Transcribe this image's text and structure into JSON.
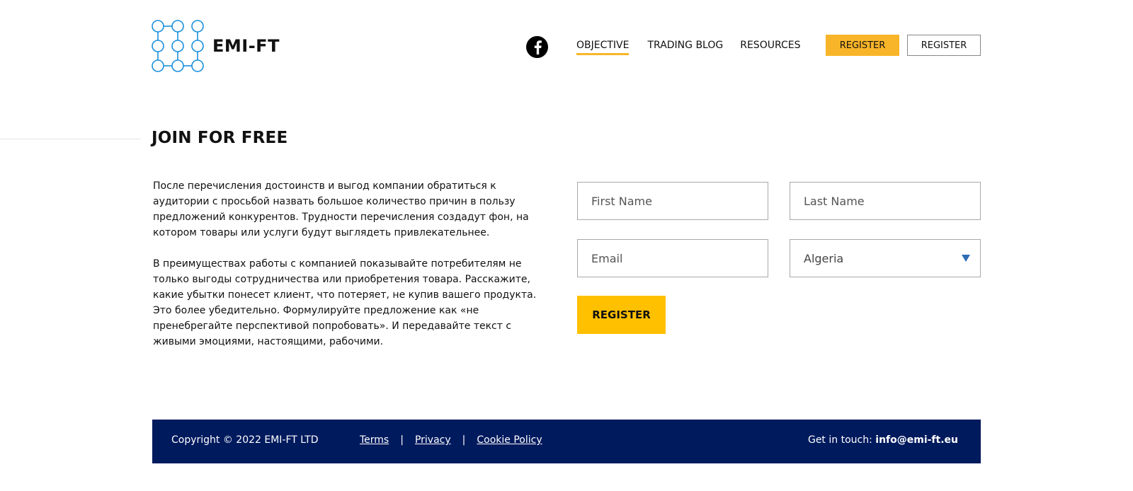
{
  "header": {
    "logo_text": "EMI-FT",
    "social": "facebook-icon",
    "nav": [
      {
        "label": "OBJECTIVE",
        "active": true
      },
      {
        "label": "TRADING BLOG",
        "active": false
      },
      {
        "label": "RESOURCES",
        "active": false
      }
    ],
    "register_primary": "REGISTER",
    "register_secondary": "REGISTER"
  },
  "main": {
    "title": "JOIN FOR FREE",
    "paragraphs": [
      "После перечисления достоинств и выгод компании обратиться к аудитории с просьбой назвать большое количество причин в пользу предложений конкурентов. Трудности перечисления создадут фон, на котором товары или услуги будут выглядеть привлекательнее.",
      "В преимуществах работы с компанией показывайте потребителям не только выгоды сотрудничества или приобретения товара. Расскажите, какие убытки понесет клиент, что потеряет, не купив вашего продукта. Это более убедительно. Формулируйте предложение как «не пренебрегайте перспективой попробовать». И передавайте текст с живыми эмоциями, настоящими, рабочими."
    ]
  },
  "form": {
    "first_name": {
      "placeholder": "First Name",
      "value": ""
    },
    "last_name": {
      "placeholder": "Last Name",
      "value": ""
    },
    "email": {
      "placeholder": "Email",
      "value": ""
    },
    "country": {
      "selected": "Algeria"
    },
    "submit_label": "REGISTER"
  },
  "footer": {
    "copyright": "Copyright © 2022 EMI-FT LTD",
    "links": [
      "Terms",
      "Privacy",
      "Cookie Policy"
    ],
    "separator": "|",
    "contact_label": "Get in touch:",
    "contact_email": "info@emi-ft.eu"
  },
  "colors": {
    "accent": "#f9b529",
    "button": "#ffc000",
    "footer_bg": "#001a5e",
    "logo_blue": "#1a8fdd"
  }
}
